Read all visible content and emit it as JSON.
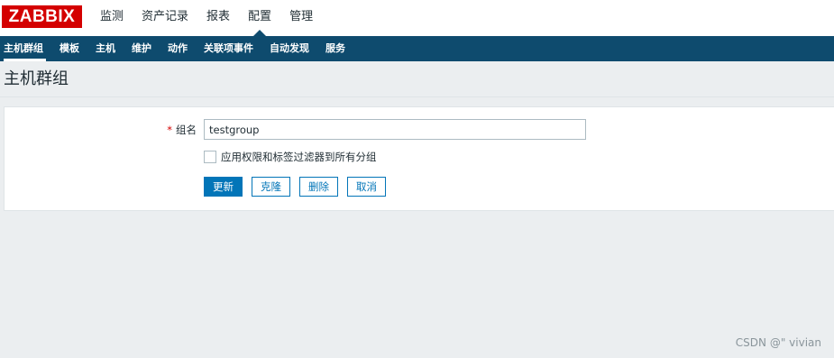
{
  "app": {
    "logo_text": "ZABBIX"
  },
  "main_menu": {
    "items": [
      {
        "label": "监测"
      },
      {
        "label": "资产记录"
      },
      {
        "label": "报表"
      },
      {
        "label": "配置"
      },
      {
        "label": "管理"
      }
    ],
    "active_index": 3
  },
  "sub_menu": {
    "items": [
      {
        "label": "主机群组"
      },
      {
        "label": "模板"
      },
      {
        "label": "主机"
      },
      {
        "label": "维护"
      },
      {
        "label": "动作"
      },
      {
        "label": "关联项事件"
      },
      {
        "label": "自动发现"
      },
      {
        "label": "服务"
      }
    ],
    "active_index": 0
  },
  "page": {
    "title": "主机群组"
  },
  "form": {
    "name_required_mark": "*",
    "name_label": "组名",
    "name_value": "testgroup",
    "apply_checkbox_label": "应用权限和标签过滤器到所有分组",
    "apply_checkbox_checked": false,
    "buttons": {
      "update": "更新",
      "clone": "克隆",
      "delete": "删除",
      "cancel": "取消"
    }
  },
  "watermark": {
    "text": "CSDN @\" vivian"
  },
  "colors": {
    "brand_red": "#d40000",
    "nav_dark_blue": "#0e4b6e",
    "primary_blue": "#0275b8",
    "page_background": "#ebeef0"
  }
}
